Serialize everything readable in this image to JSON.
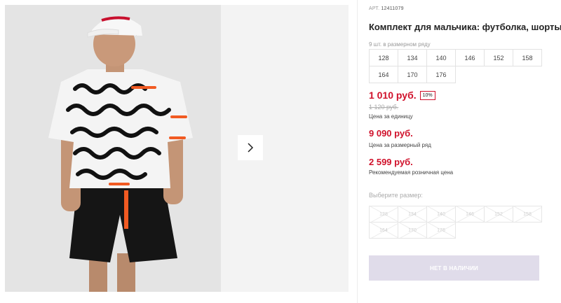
{
  "product": {
    "article_label": "АРТ.",
    "article_number": "12411079",
    "title": "Комплект для мальчика: футболка, шорты",
    "series_note": "9 шт. в размерном ряду",
    "series_sizes": [
      "128",
      "134",
      "140",
      "146",
      "152",
      "158",
      "164",
      "170",
      "176"
    ]
  },
  "pricing": {
    "unit_price": "1 010 руб.",
    "discount": "10%",
    "old_price": "1 120 руб.",
    "unit_label": "Цена за единицу",
    "series_price": "9 090 руб.",
    "series_label": "Цена за размерный ряд",
    "rrp_price": "2 599 руб.",
    "rrp_label": "Рекомендуемая розничная цена"
  },
  "size_picker": {
    "label": "Выберите размер:",
    "sizes": [
      "128",
      "134",
      "140",
      "146",
      "152",
      "158",
      "164",
      "170",
      "176"
    ]
  },
  "buy_button": {
    "label": "НЕТ В НАЛИЧИИ"
  },
  "colors": {
    "price_red": "#d0112b",
    "disabled_button": "#e0dcea"
  },
  "icons": {
    "next": "chevron-right-icon"
  }
}
